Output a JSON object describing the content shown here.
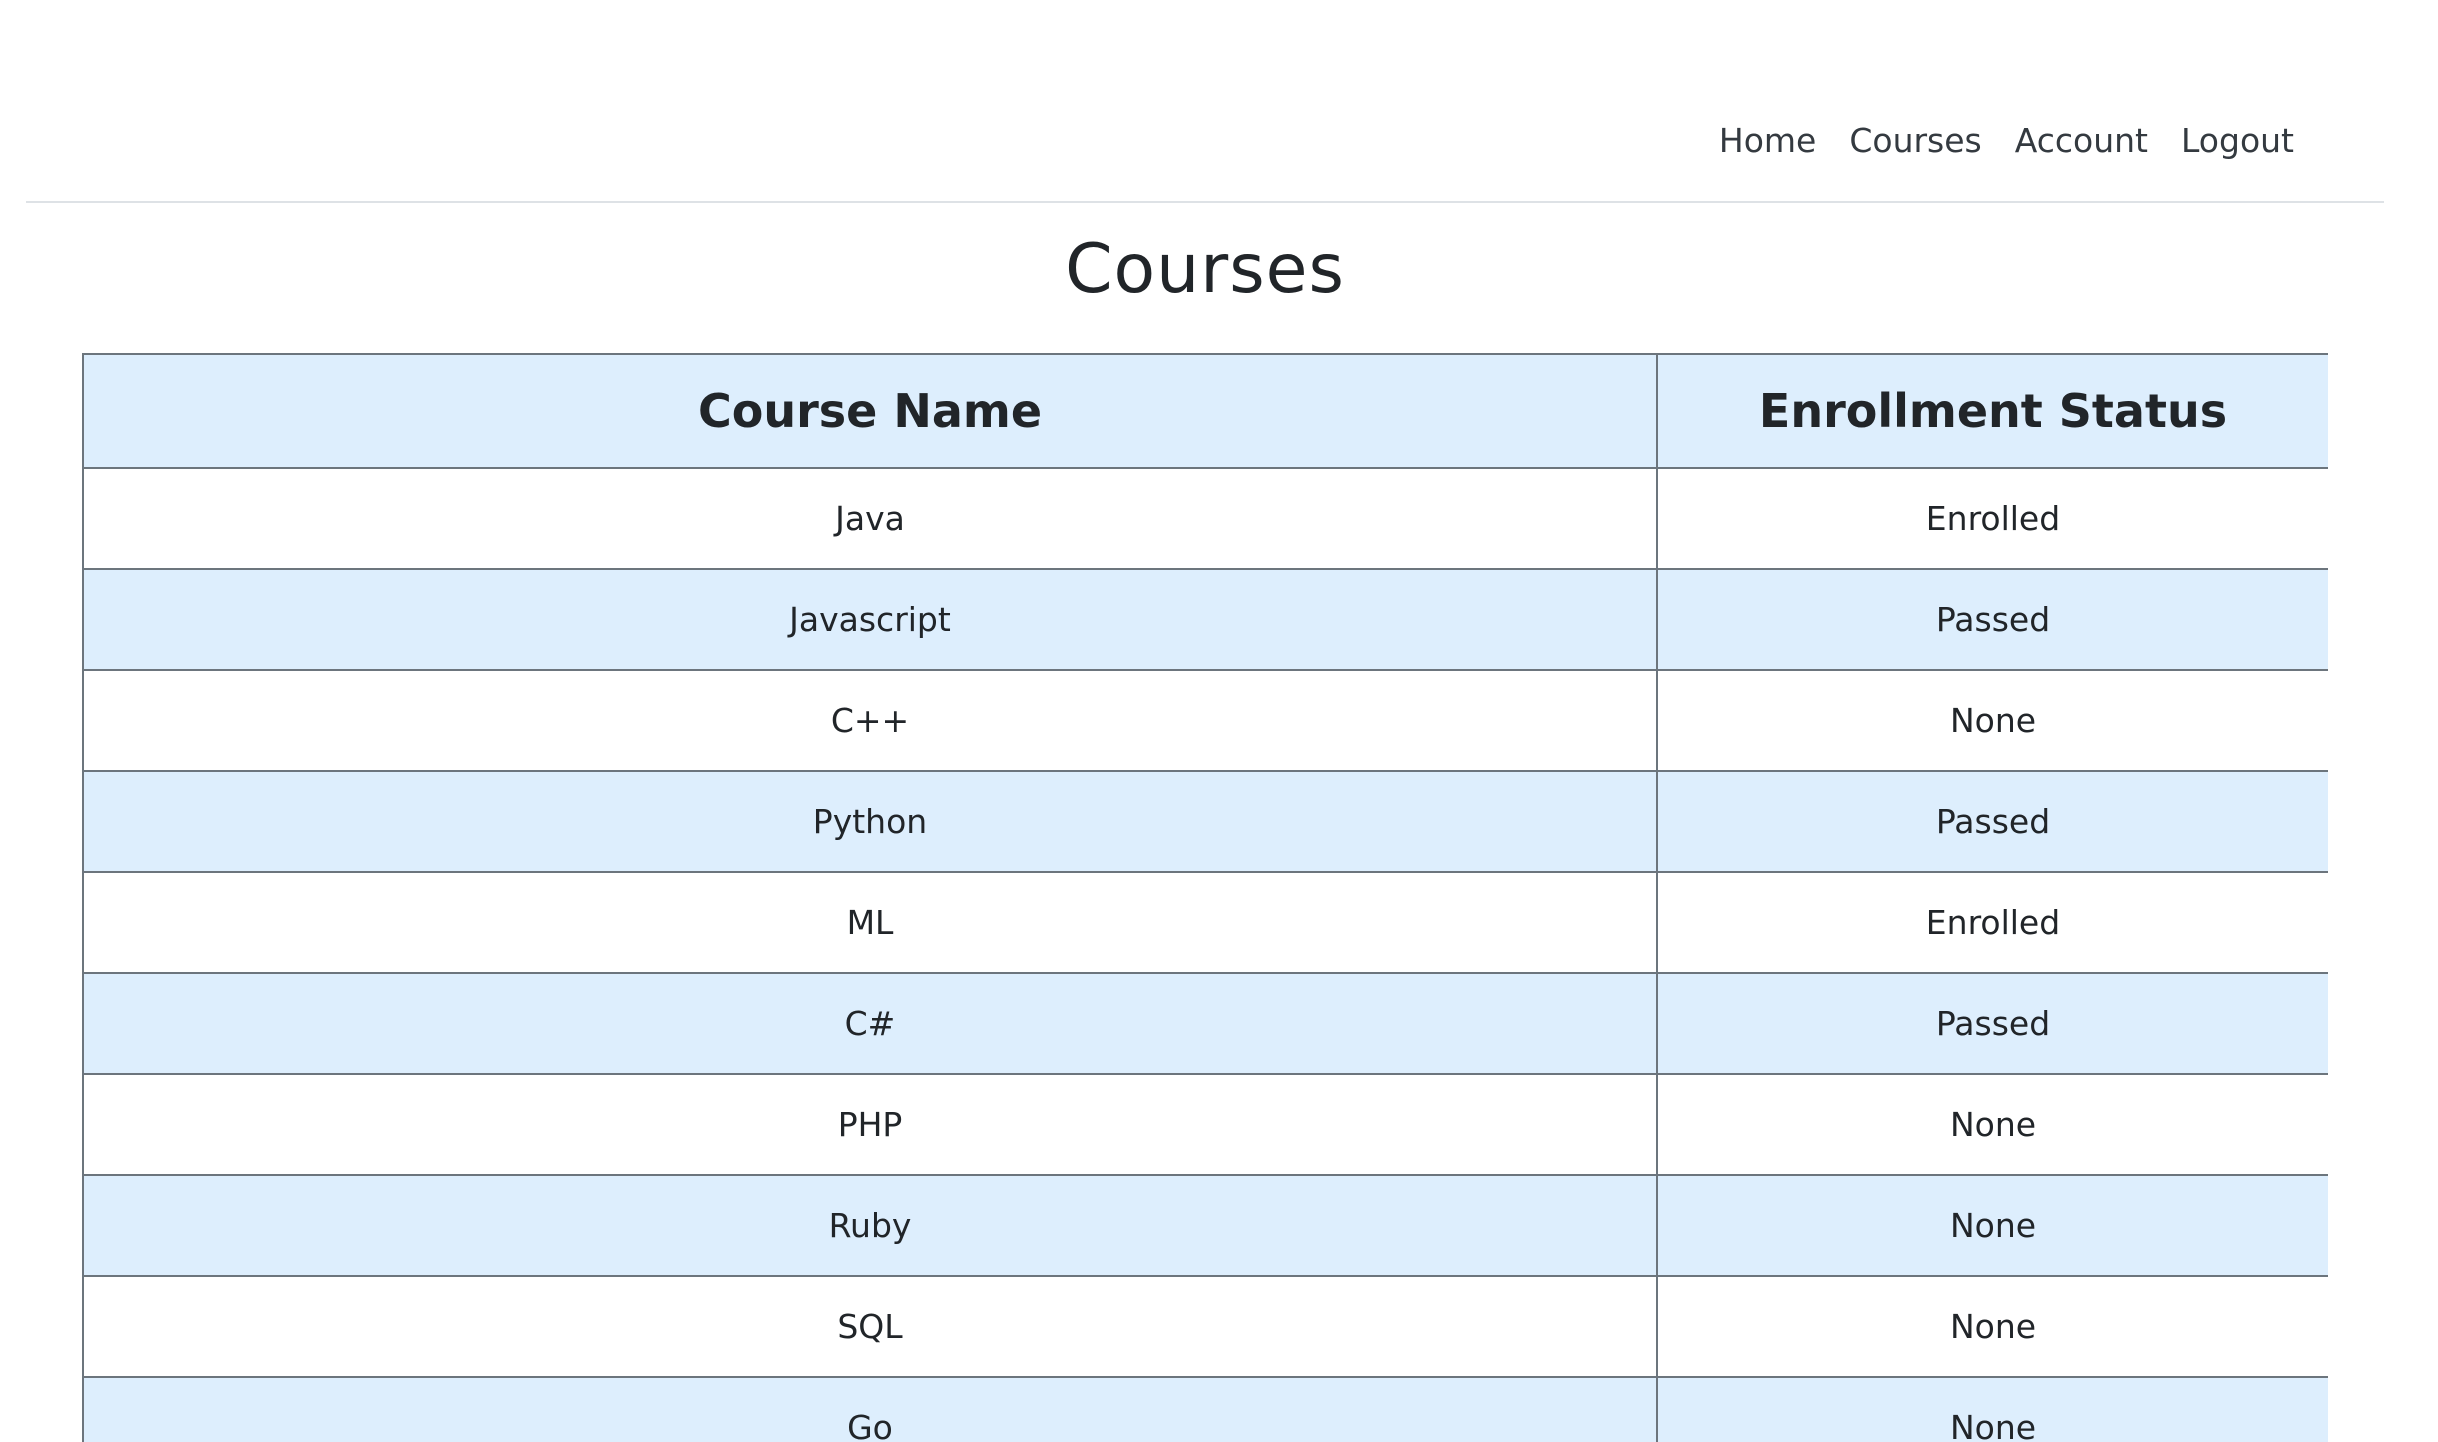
{
  "nav": {
    "links": [
      "Home",
      "Courses",
      "Account",
      "Logout"
    ]
  },
  "page": {
    "title": "Courses"
  },
  "table": {
    "headers": [
      "Course Name",
      "Enrollment Status"
    ],
    "rows": [
      [
        "Java",
        "Enrolled"
      ],
      [
        "Javascript",
        "Passed"
      ],
      [
        "C++",
        "None"
      ],
      [
        "Python",
        "Passed"
      ],
      [
        "ML",
        "Enrolled"
      ],
      [
        "C#",
        "Passed"
      ],
      [
        "PHP",
        "None"
      ],
      [
        "Ruby",
        "None"
      ],
      [
        "SQL",
        "None"
      ],
      [
        "Go",
        "None"
      ]
    ]
  },
  "colors": {
    "header_bg": "#ddeefd",
    "stripe_bg": "#ddeefd",
    "border": "#6c757d"
  }
}
